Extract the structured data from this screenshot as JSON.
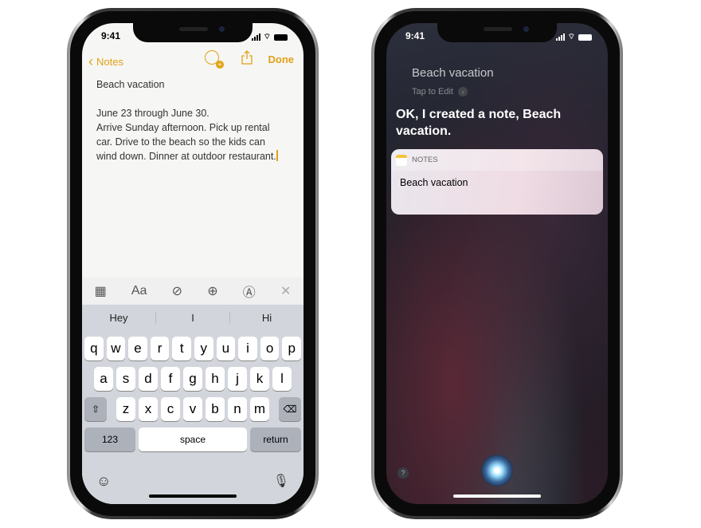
{
  "phone_left": {
    "status": {
      "time": "9:41"
    },
    "nav": {
      "back_label": "Notes",
      "done_label": "Done",
      "icons": [
        "add-person-icon",
        "share-icon"
      ]
    },
    "note": {
      "title": "Beach vacation",
      "lines": [
        "June 23 through June 30.",
        "Arrive Sunday afternoon. Pick up rental",
        "car. Drive to the beach so the kids can",
        "wind down. Dinner at outdoor restaurant."
      ]
    },
    "toolbar": {
      "font_label": "Aa",
      "icons": [
        "table-icon",
        "checklist-icon",
        "plus-icon",
        "markup-icon",
        "close-icon"
      ]
    },
    "keyboard": {
      "suggestions": [
        "Hey",
        "I",
        "Hi"
      ],
      "row1": [
        "q",
        "w",
        "e",
        "r",
        "t",
        "y",
        "u",
        "i",
        "o",
        "p"
      ],
      "row2": [
        "a",
        "s",
        "d",
        "f",
        "g",
        "h",
        "j",
        "k",
        "l"
      ],
      "row3": [
        "z",
        "x",
        "c",
        "v",
        "b",
        "n",
        "m"
      ],
      "numbers_label": "123",
      "space_label": "space",
      "return_label": "return"
    },
    "accent": "#e0a216"
  },
  "phone_right": {
    "status": {
      "time": "9:41"
    },
    "query": "Beach vacation",
    "tap_to_edit": "Tap to Edit",
    "reply": "OK, I created a note, Beach vacation.",
    "card": {
      "app": "NOTES",
      "title": "Beach vacation"
    },
    "help": "?"
  }
}
